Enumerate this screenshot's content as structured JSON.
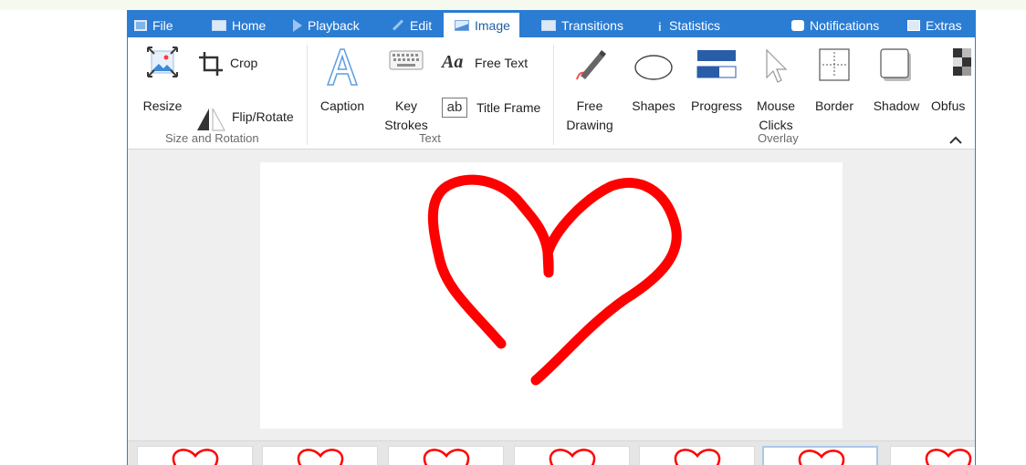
{
  "tabs": {
    "file": "File",
    "home": "Home",
    "playback": "Playback",
    "edit": "Edit",
    "image": "Image",
    "transitions": "Transitions",
    "statistics": "Statistics",
    "notifications": "Notifications",
    "extras": "Extras"
  },
  "active_tab": "Image",
  "ribbon": {
    "resize": "Resize",
    "crop": "Crop",
    "flip_rotate": "Flip/Rotate",
    "caption": "Caption",
    "key_line1": "Key",
    "key_line2": "Strokes",
    "free_text": "Free Text",
    "title_frame": "Title Frame",
    "free_line1": "Free",
    "free_line2": "Drawing",
    "shapes": "Shapes",
    "progress": "Progress",
    "mouse_line1": "Mouse",
    "mouse_line2": "Clicks",
    "border": "Border",
    "shadow": "Shadow",
    "obfuscate": "Obfus"
  },
  "groups": {
    "size_rotation": "Size and Rotation",
    "text": "Text",
    "overlay": "Overlay"
  },
  "colors": {
    "accent": "#2b7cd3",
    "heart": "#ff0000"
  },
  "frames_visible": 7,
  "selected_frame": 6
}
